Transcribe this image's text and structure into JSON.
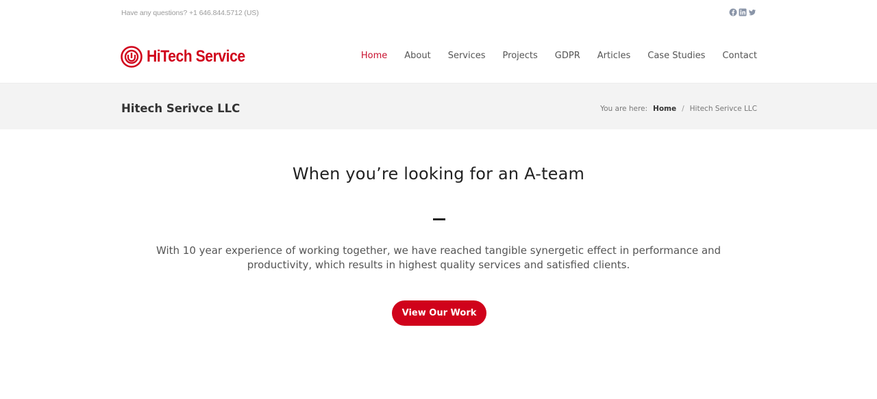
{
  "topbar": {
    "contact_text": "Have any questions? +1 646.844.5712 (US)",
    "social": [
      {
        "icon": "facebook-icon"
      },
      {
        "icon": "linkedin-icon"
      },
      {
        "icon": "twitter-icon"
      }
    ]
  },
  "header": {
    "brand_name": "HiTech Service",
    "brand_color": "#d0021b",
    "nav": [
      {
        "label": "Home",
        "active": true
      },
      {
        "label": "About"
      },
      {
        "label": "Services"
      },
      {
        "label": "Projects"
      },
      {
        "label": "GDPR"
      },
      {
        "label": "Articles"
      },
      {
        "label": "Case Studies"
      },
      {
        "label": "Contact"
      }
    ]
  },
  "titlebar": {
    "page_title": "Hitech Serivce LLC",
    "breadcrumb_prefix": "You are here:",
    "breadcrumb_home": "Home",
    "breadcrumb_sep": "/",
    "breadcrumb_current": "Hitech Serivce LLC"
  },
  "hero": {
    "title": "When you’re looking for an A-team",
    "text": "With 10 year experience of working together, we have reached tangible synergetic effect in performance and productivity, which results in highest quality services and satisfied clients.",
    "cta_label": "View Our Work"
  }
}
